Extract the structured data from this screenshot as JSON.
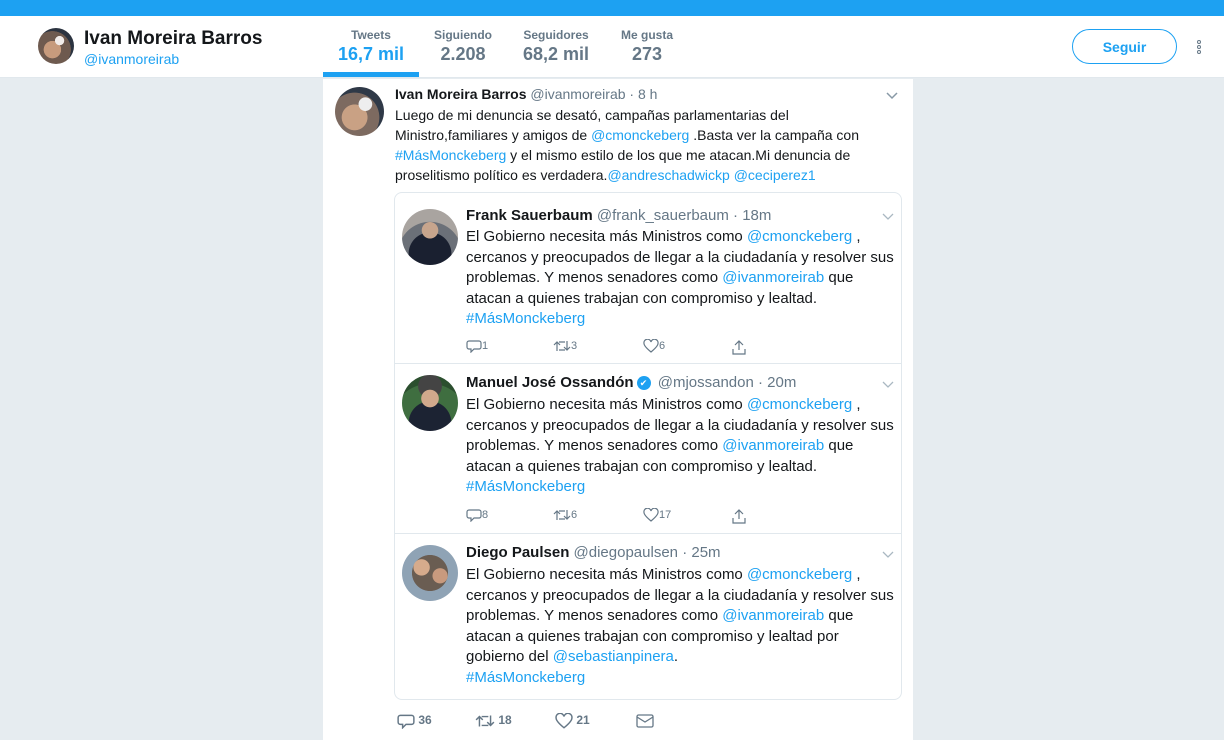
{
  "profile": {
    "name": "Ivan Moreira Barros",
    "handle": "@ivanmoreirab",
    "follow_label": "Seguir"
  },
  "stats": [
    {
      "label": "Tweets",
      "value": "16,7 mil"
    },
    {
      "label": "Siguiendo",
      "value": "2.208"
    },
    {
      "label": "Seguidores",
      "value": "68,2 mil"
    },
    {
      "label": "Me gusta",
      "value": "273"
    }
  ],
  "tweet": {
    "name": "Ivan Moreira Barros",
    "handle": "@ivanmoreirab",
    "time": "· 8 h",
    "text_1": "Luego de mi denuncia se desató, campañas parlamentarias del Ministro,familiares y amigos de ",
    "mention_1": "@cmonckeberg",
    "text_2": " .Basta ver la campaña con ",
    "hashtag_1": "#MásMonckeberg",
    "text_3": " y el mismo estilo de los que me atacan.Mi denuncia de proselitismo político es verdadera.",
    "mention_2": "@andreschadwickp",
    "text_4": " ",
    "mention_3": "@ceciperez1",
    "replies": "36",
    "retweets": "18",
    "likes": "21"
  },
  "thread": [
    {
      "name": "Frank Sauerbaum",
      "handle": "@frank_sauerbaum",
      "time": "· 18m",
      "t1": "El Gobierno necesita más Ministros como ",
      "m1": "@cmonckeberg",
      "t2": " , cercanos y preocupados de llegar a la ciudadanía y resolver sus problemas. Y menos senadores como ",
      "m2": "@ivanmoreirab",
      "t3": " que atacan a quienes trabajan con compromiso y lealtad.",
      "hashtag": "#MásMonckeberg",
      "replies": "1",
      "retweets": "3",
      "likes": "6"
    },
    {
      "name": "Manuel José Ossandón",
      "handle": "@mjossandon",
      "time": "· 20m",
      "t1": "El Gobierno necesita más Ministros como ",
      "m1": "@cmonckeberg",
      "t2": " , cercanos y preocupados de llegar a la ciudadanía y resolver sus problemas. Y menos senadores como ",
      "m2": "@ivanmoreirab",
      "t3": " que atacan a quienes trabajan con compromiso y lealtad.",
      "hashtag": "#MásMonckeberg",
      "replies": "8",
      "retweets": "6",
      "likes": "17"
    },
    {
      "name": "Diego Paulsen",
      "handle": "@diegopaulsen",
      "time": "· 25m",
      "t1": "El Gobierno necesita más Ministros como ",
      "m1": "@cmonckeberg",
      "t2": " , cercanos y preocupados de llegar a la ciudadanía y resolver sus problemas. Y menos senadores como ",
      "m2": "@ivanmoreirab",
      "t3": " que atacan a quienes trabajan con compromiso y lealtad por gobierno del ",
      "m3": "@sebastianpinera",
      "t4": ".",
      "hashtag": "#MásMonckeberg"
    }
  ],
  "colors": {
    "accent": "#1da1f2",
    "muted": "#657786",
    "background": "#e6ecf0"
  }
}
